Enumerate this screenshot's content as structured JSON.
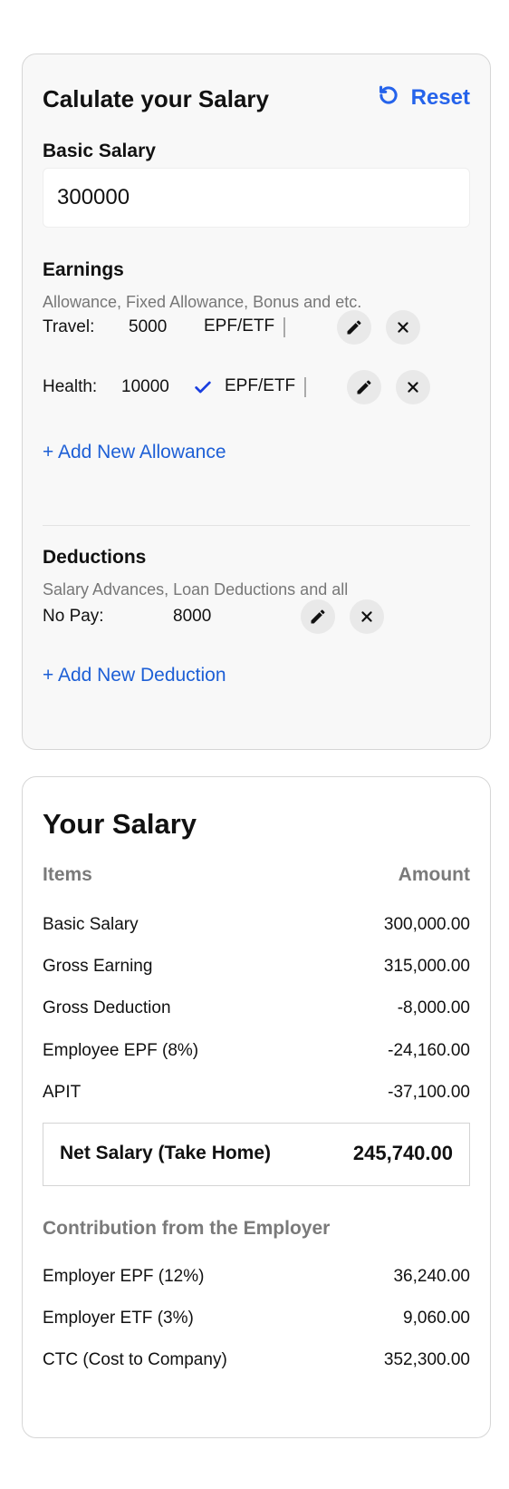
{
  "calculator": {
    "title": "Calulate your Salary",
    "reset_label": "Reset",
    "basic_salary_label": "Basic Salary",
    "basic_salary_value": "300000",
    "earnings": {
      "title": "Earnings",
      "subtitle": "Allowance, Fixed Allowance, Bonus and etc.",
      "items": [
        {
          "name": "Travel:",
          "amount": "5000",
          "epf_label": "EPF/ETF",
          "epf_checked": false
        },
        {
          "name": "Health:",
          "amount": "10000",
          "epf_label": "EPF/ETF",
          "epf_checked": true
        }
      ],
      "add_label": "+ Add New Allowance"
    },
    "deductions": {
      "title": "Deductions",
      "subtitle": "Salary Advances, Loan Deductions and all",
      "items": [
        {
          "name": "No Pay:",
          "amount": "8000"
        }
      ],
      "add_label": "+ Add New Deduction"
    }
  },
  "salary": {
    "title": "Your Salary",
    "col_items": "Items",
    "col_amount": "Amount",
    "rows": [
      {
        "label": "Basic Salary",
        "value": "300,000.00"
      },
      {
        "label": "Gross Earning",
        "value": "315,000.00"
      },
      {
        "label": "Gross Deduction",
        "value": "-8,000.00"
      },
      {
        "label": "Employee EPF (8%)",
        "value": "-24,160.00"
      },
      {
        "label": "APIT",
        "value": "-37,100.00"
      }
    ],
    "net_label": "Net Salary (Take Home)",
    "net_value": "245,740.00",
    "employer_title": "Contribution from the Employer",
    "employer_rows": [
      {
        "label": "Employer EPF (12%)",
        "value": "36,240.00"
      },
      {
        "label": "Employer ETF (3%)",
        "value": "9,060.00"
      },
      {
        "label": "CTC (Cost to Company)",
        "value": "352,300.00"
      }
    ]
  },
  "colors": {
    "accent": "#2563eb",
    "link": "#1d5fd6",
    "check": "#1a3fe0",
    "muted_text": "#777777"
  },
  "icons": [
    "reset-icon",
    "edit-icon",
    "close-icon",
    "check-icon"
  ]
}
